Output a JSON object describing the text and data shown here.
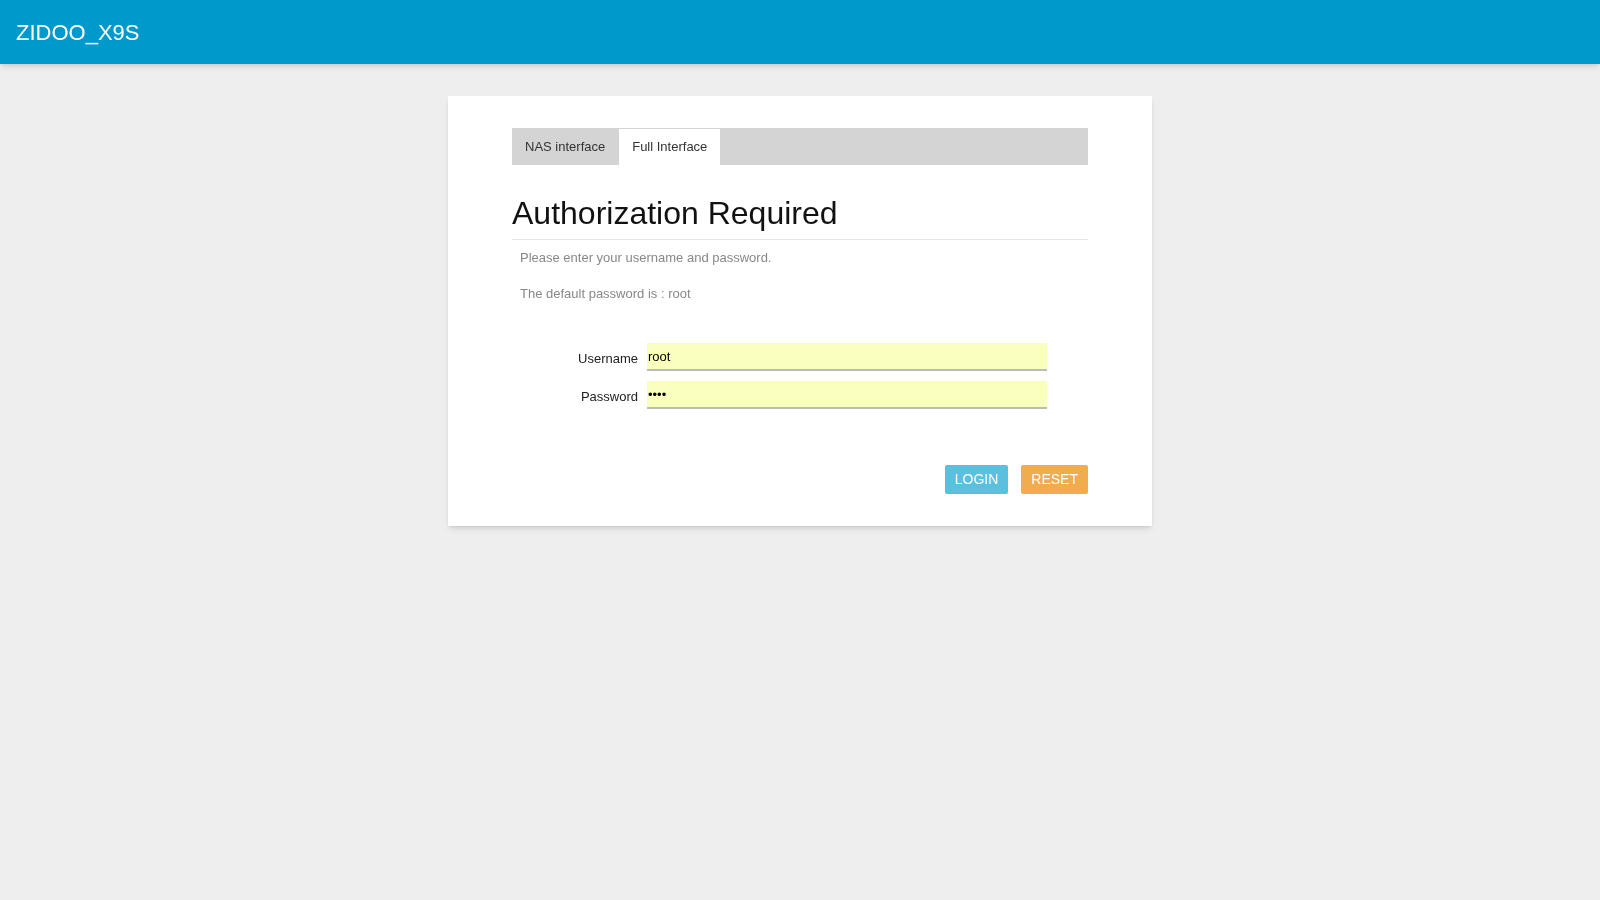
{
  "header": {
    "title": "ZIDOO_X9S"
  },
  "tabs": [
    {
      "label": "NAS interface",
      "selected": false
    },
    {
      "label": "Full Interface",
      "selected": true
    }
  ],
  "heading": "Authorization Required",
  "messages": [
    "Please enter your username and password.",
    "The default password is : root"
  ],
  "fields": [
    {
      "label": "Username",
      "value": "root"
    },
    {
      "label": "Password",
      "value": "••••"
    }
  ],
  "buttons": [
    {
      "label": "LOGIN",
      "kind": "primary"
    },
    {
      "label": "RESET",
      "kind": "warning"
    }
  ]
}
